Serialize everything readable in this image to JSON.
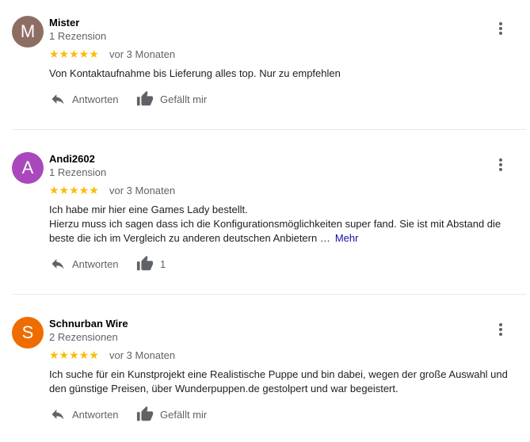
{
  "reviews": [
    {
      "initial": "M",
      "avatar_color": "#8d6e63",
      "name": "Mister",
      "review_count": "1 Rezension",
      "stars": "★★★★★",
      "date": "vor 3 Monaten",
      "text_lines": [
        "Von Kontaktaufnahme bis Lieferung alles top. Nur zu empfehlen"
      ],
      "reply_label": "Antworten",
      "like_label": "Gefällt mir"
    },
    {
      "initial": "A",
      "avatar_color": "#ab47bc",
      "name": "Andi2602",
      "review_count": "1 Rezension",
      "stars": "★★★★★",
      "date": "vor 3 Monaten",
      "text_lines": [
        "Ich habe mir hier eine Games Lady bestellt.",
        "Hierzu muss ich sagen dass ich die Konfigurationsmöglichkeiten super fand. Sie ist mit Abstand die",
        "beste die ich im Vergleich zu anderen deutschen Anbietern …"
      ],
      "more_label": "Mehr",
      "reply_label": "Antworten",
      "like_label": "1"
    },
    {
      "initial": "S",
      "avatar_color": "#ef6c00",
      "name": "Schnurban Wire",
      "review_count": "2 Rezensionen",
      "stars": "★★★★★",
      "date": "vor 3 Monaten",
      "text_lines": [
        "Ich suche für ein Kunstprojekt eine Realistische Puppe und bin dabei, wegen der große Auswahl und",
        "den günstige Preisen, über Wunderpuppen.de gestolpert und war begeistert."
      ],
      "reply_label": "Antworten",
      "like_label": "Gefällt mir"
    }
  ],
  "colors": {
    "star": "#fbbc04",
    "link": "#1a0dab",
    "secondary_text": "#5f6368"
  },
  "icons": {
    "reply": "reply-arrow-icon",
    "like": "thumbs-up-icon",
    "menu": "more-vert-icon"
  }
}
